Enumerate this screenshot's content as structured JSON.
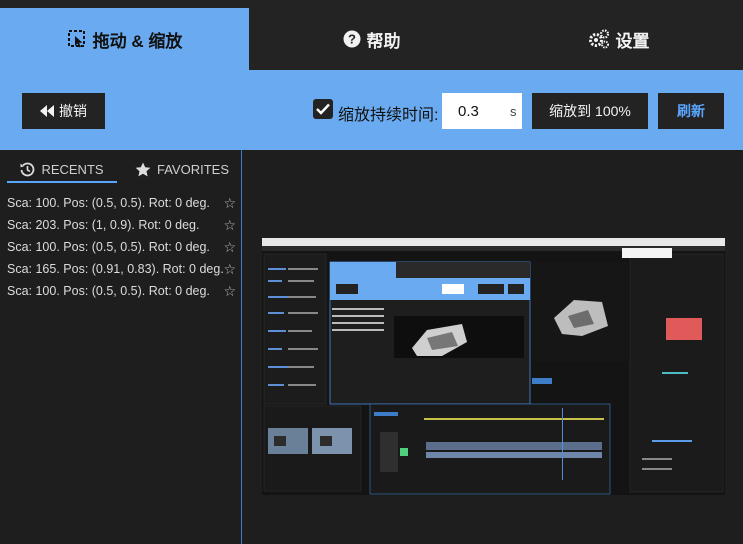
{
  "tabs": [
    {
      "label": "拖动 & 缩放",
      "icon": "drag-zoom-icon",
      "active": true
    },
    {
      "label": "帮助",
      "icon": "help-icon"
    },
    {
      "label": "设置",
      "icon": "gears-icon"
    }
  ],
  "toolbar": {
    "undo_label": "撤销",
    "duration_checked": true,
    "duration_label": "缩放持续时间:",
    "duration_value": "0.3",
    "duration_unit": "s",
    "zoom100_label": "缩放到 100%",
    "refresh_label": "刷新"
  },
  "panel": {
    "recents_tab": "RECENTS",
    "favorites_tab": "FAVORITES",
    "items": [
      "Sca: 100. Pos: (0.5, 0.5). Rot: 0 deg.",
      "Sca: 203. Pos: (1, 0.9). Rot: 0 deg.",
      "Sca: 100. Pos: (0.5, 0.5). Rot: 0 deg.",
      "Sca: 165. Pos: (0.91, 0.83). Rot: 0 deg.",
      "Sca: 100. Pos: (0.5, 0.5). Rot: 0 deg."
    ]
  },
  "colors": {
    "accent": "#6aaaf0",
    "dark": "#232323",
    "link": "#5aa6ff"
  }
}
